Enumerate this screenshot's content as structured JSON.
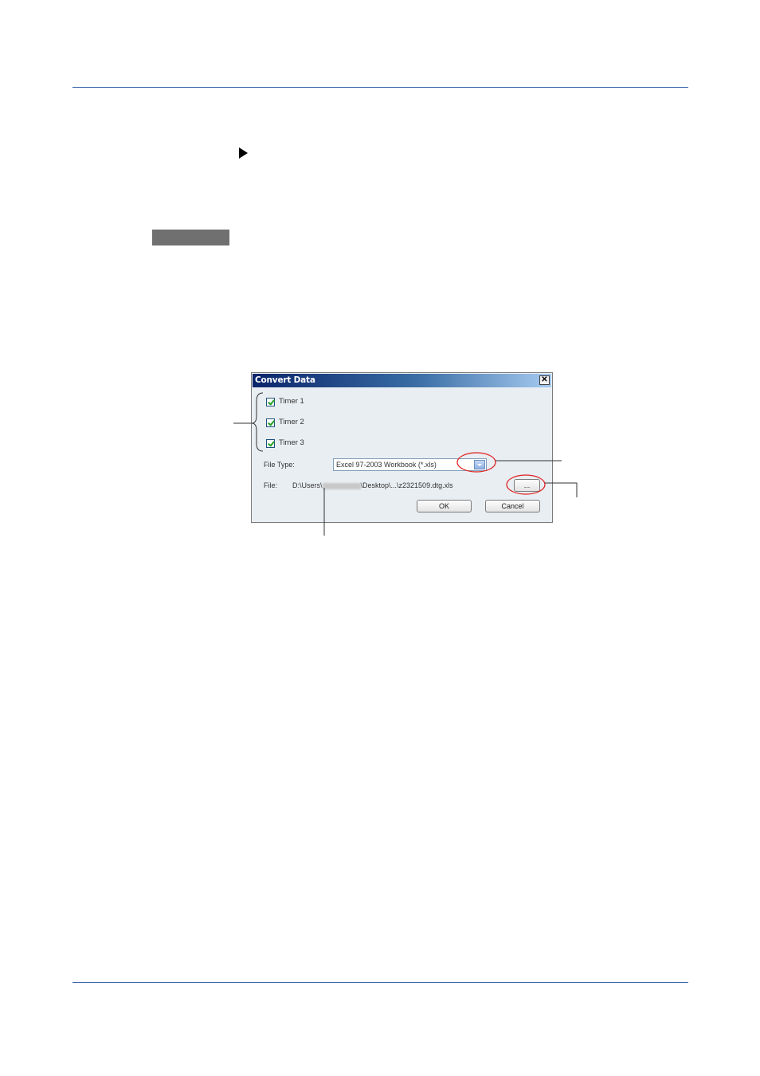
{
  "dialog": {
    "title": "Convert Data",
    "close_glyph": "✕",
    "checkboxes": [
      {
        "label": "Timer 1",
        "checked": true
      },
      {
        "label": "Timer 2",
        "checked": true
      },
      {
        "label": "Timer 3",
        "checked": true
      }
    ],
    "file_type_label": "File Type:",
    "file_type_value": "Excel 97-2003 Workbook (*.xls)",
    "file_label": "File:",
    "file_path_prefix": "D:\\Users\\",
    "file_path_suffix": "\\Desktop\\...\\z2321509.dtg.xls",
    "browse_label": "...",
    "ok_label": "OK",
    "cancel_label": "Cancel"
  },
  "colors": {
    "rule": "#2e5aa8",
    "highlight_circle": "#e02020",
    "title_gradient_start": "#0a246a"
  },
  "icons": {
    "section_marker": "right-triangle-icon",
    "close": "close-icon",
    "checkbox": "checkmark-icon",
    "dropdown": "chevron-down-icon"
  }
}
